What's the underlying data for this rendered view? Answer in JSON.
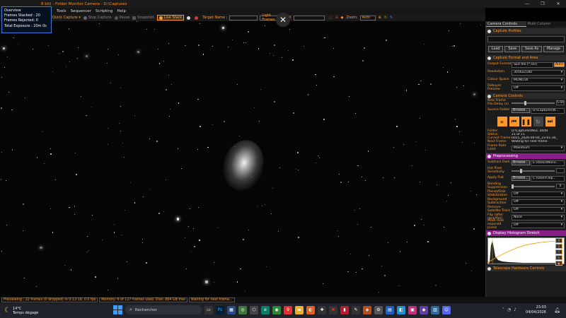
{
  "window": {
    "title": "8 bit) - Folder Monitor Camera - D:\\Captures",
    "controls": [
      "—",
      "❐",
      "✕"
    ]
  },
  "menu": [
    "Tools",
    "Sequencer",
    "Scripting",
    "Help"
  ],
  "toolbar": {
    "quick_capture": "Quick Capture",
    "stop_capture": "Stop Capture",
    "pause": "Pause",
    "snapshot": "Snapshot",
    "live_stack": "Live Stack",
    "target_name_label": "Target Name :",
    "target_name_value": "",
    "frame_type": "Light Frames",
    "fx_label": "FX",
    "fx_value": "",
    "zoom_label": "Zoom:",
    "zoom_value": "Auto"
  },
  "overview": {
    "title": "Overview",
    "frames_stacked": "Frames Stacked : 20",
    "frames_rejected": "Frames Rejected: 0",
    "total_exposure": "Total Exposure :     20m 0s"
  },
  "panel": {
    "tab_active": "Camera Controls",
    "tab_inactive": "Multi Column",
    "capture_profiles": {
      "header": "Capture Profiles",
      "buttons": [
        "Load",
        "Save",
        "Save As",
        "Manage"
      ]
    },
    "capture_format": {
      "header": "Capture Format and Area",
      "output_format_label": "Output Format",
      "output_format_value": "SER file (*.ser)",
      "auto": "Auto",
      "resolution_label": "Resolution",
      "resolution_value": "3056x2180",
      "colour_space_label": "Colour Space",
      "colour_space_value": "MONO16",
      "debayer_label": "Debayer Preview",
      "debayer_value": "Off"
    },
    "camera_controls": {
      "header": "Camera Controls",
      "new_frame_delay_label": "New Frame File Delay (s)",
      "new_frame_delay_value": "5.00",
      "source_folder_label": "Source Folder",
      "browse": "Browse...",
      "source_folder_value": "D:\\Captures\\N...",
      "folder_label": "Folder:",
      "folder_value": "D:\\Captures\\NGC 4449",
      "status_label": "Status:",
      "status_value": "21 of 21",
      "current_frame_label": "Current Frame:",
      "current_frame_value": "0025_2026-04-04_23-01-30_",
      "next_frame_label": "Next Frame:",
      "next_frame_value": "Waiting for next frame",
      "frame_rate_label": "Frame Rate Limit",
      "frame_rate_value": "Maximum"
    },
    "preprocessing": {
      "header": "Preprocessing",
      "subtract_dark_label": "Subtract Dark",
      "subtract_dark_value": "E:\\darks\\Mono...",
      "hot_pixel_label": "Hot Pixel Sensitivity",
      "hot_pixel_value": "",
      "apply_flat_label": "Apply Flat",
      "apply_flat_value": "C:\\Users\\Tep...",
      "banding_label": "Banding Suppression",
      "banding_value": "0",
      "planet_stab_label": "Planet/Disk Stabilization",
      "planet_stab_value": "Off",
      "bg_sub_label": "Background Subtraction",
      "bg_sub_value": "Off",
      "satellite_label": "Remove Satellite Trails",
      "satellite_value": "Off",
      "flip_label": "Flip (after dark/flat)",
      "flip_value": "None",
      "mask_label": "Mask over exposed pixels",
      "mask_value": "Off"
    },
    "histogram": {
      "header": "Display Histogram Stretch",
      "side_buttons": [
        "X",
        "Σ",
        "↑",
        "↻",
        "▣"
      ]
    },
    "telescope": {
      "header": "Telescope Hardware Controls"
    }
  },
  "statusbar": {
    "preview": "Previewing : 22 frames (0 dropped) in 0:13:18, 0.0 fps",
    "memory": "Memory: 6 of 127 frames used. Disk: 884 GB free",
    "waiting": "Waiting for next frame..."
  },
  "taskbar": {
    "temperature": "14°C",
    "weather": "Temps dégagé",
    "search_placeholder": "Rechercher",
    "time": "23:03",
    "date": "04/04/2026"
  },
  "colors": {
    "accent": "#ff9a2a",
    "overview_border": "#2f7de0",
    "section_purple": "#8a1f8a"
  }
}
